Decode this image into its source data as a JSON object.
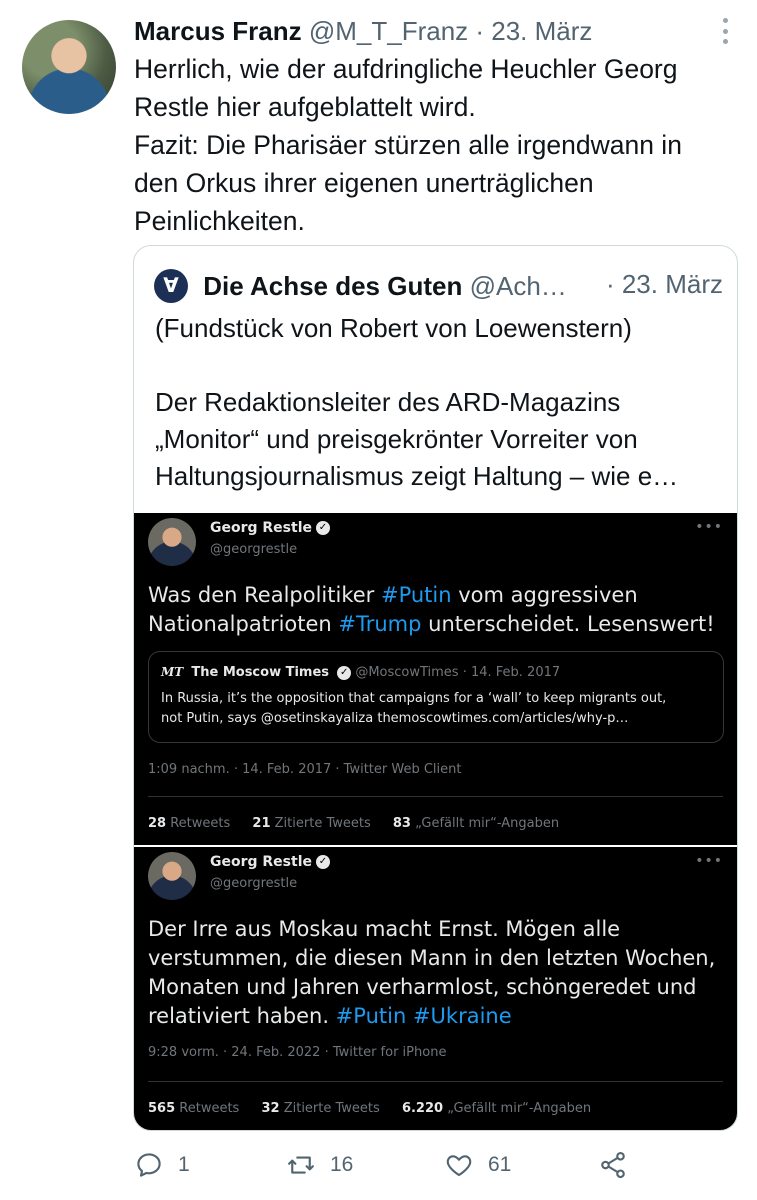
{
  "tweet": {
    "author_name": "Marcus Franz",
    "author_meta": "@M_T_Franz · 23. März",
    "text": "Herrlich, wie der aufdringliche Heuchler Georg\nRestle hier aufgeblattelt wird.\nFazit: Die Pharisäer stürzen alle irgendwann in\nden Orkus ihrer eigenen unerträglichen\nPeinlichkeiten.",
    "reply_count": "1",
    "retweet_count": "16",
    "like_count": "61"
  },
  "quoted": {
    "logo": "∀",
    "name": "Die Achse des Guten",
    "handle": "@Ach…",
    "date": "· 23. März",
    "text": "(Fundstück von Robert von Loewenstern)\n\nDer Redaktionsleiter des ARD-Magazins\n„Monitor“ und preisgekrönter Vorreiter von\nHaltungsjournalismus zeigt Haltung – wie e…"
  },
  "panel1": {
    "name": "Georg Restle",
    "handle": "@georgrestle",
    "text_a": "Was den Realpolitiker ",
    "hash_a": "#Putin",
    "text_b": " vom aggressiven\nNationalpatrioten ",
    "hash_b": "#Trump",
    "text_c": " unterscheidet. Lesenswert!",
    "inner": {
      "logo": "MT",
      "name": "The Moscow Times",
      "meta": "@MoscowTimes · 14. Feb. 2017",
      "text": "In Russia, it’s the opposition that campaigns for a ‘wall’ to keep migrants out,\nnot Putin, says @osetinskayaliza themoscowtimes.com/articles/why-p…"
    },
    "time": "1:09 nachm. · 14. Feb. 2017 · Twitter Web Client",
    "retweets": "28",
    "retweets_label": "Retweets",
    "quotes": "21",
    "quotes_label": "Zitierte Tweets",
    "likes": "83",
    "likes_label": "„Gefällt mir“-Angaben"
  },
  "panel2": {
    "name": "Georg Restle",
    "handle": "@georgrestle",
    "text_a": "Der Irre aus Moskau macht Ernst. Mögen alle\nverstummen, die diesen Mann in den letzten Wochen,\nMonaten und Jahren verharmlost, schöngeredet und\nrelativiert haben. ",
    "hash_a": "#Putin",
    "hash_b": "#Ukraine",
    "time": "9:28 vorm. · 24. Feb. 2022 · Twitter for iPhone",
    "retweets": "565",
    "retweets_label": "Retweets",
    "quotes": "32",
    "quotes_label": "Zitierte Tweets",
    "likes": "6.220",
    "likes_label": "„Gefällt mir“-Angaben"
  },
  "icons": {
    "reply": "reply-icon",
    "retweet": "retweet-icon",
    "like": "heart-icon",
    "share": "share-icon",
    "more": "more-icon"
  }
}
